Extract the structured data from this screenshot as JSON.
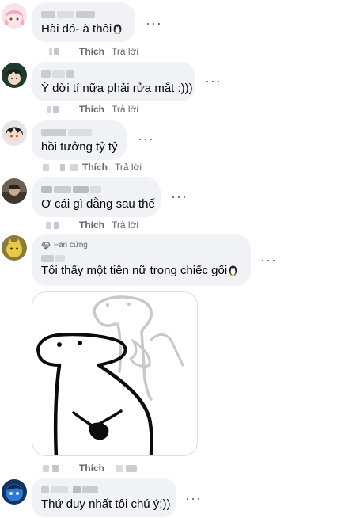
{
  "comments": [
    {
      "text": "Hài dó- à thôi",
      "has_penguin": true,
      "like_label": "Thích",
      "reply_label": "Trả lời"
    },
    {
      "text": "Ý dời tí nữa phải rửa mắt :)))",
      "like_label": "Thích",
      "reply_label": "Trả lời"
    },
    {
      "text": "hồi tưởng tỷ tỷ",
      "like_label": "Thích",
      "reply_label": "Trả lời"
    },
    {
      "text": "Ơ cái gì đằng sau thế",
      "like_label": "Thích",
      "reply_label": "Trả lời"
    },
    {
      "badge": "Fan cứng",
      "text": "Tôi thấy một tiên nữ trong chiếc gối",
      "has_penguin": true,
      "like_label": "Thích"
    },
    {
      "text": "Thứ duy nhất tôi chú ý:))"
    }
  ],
  "more_label": "···",
  "icons": {
    "options": "more-options-icon",
    "penguin": "penguin-emoji-icon",
    "fan_badge": "diamond-badge-icon"
  }
}
